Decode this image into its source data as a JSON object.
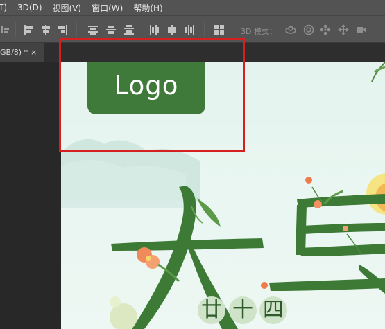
{
  "menu": {
    "items": [
      {
        "label": "T)"
      },
      {
        "label": "3D(D)"
      },
      {
        "label": "视图(V)"
      },
      {
        "label": "窗口(W)"
      },
      {
        "label": "帮助(H)"
      }
    ]
  },
  "options_bar": {
    "mode_label": "3D 模式："
  },
  "document_tab": {
    "title": "GB/8) *",
    "close_symbol": "×"
  },
  "canvas": {
    "logo_text": "Logo",
    "date_chars": [
      "廿",
      "十",
      "四"
    ]
  },
  "colors": {
    "selection_border": "#d61f1f",
    "logo_green": "#3f7a3a",
    "canvas_bg": "#e7f4ef",
    "chrome": "#535353"
  }
}
